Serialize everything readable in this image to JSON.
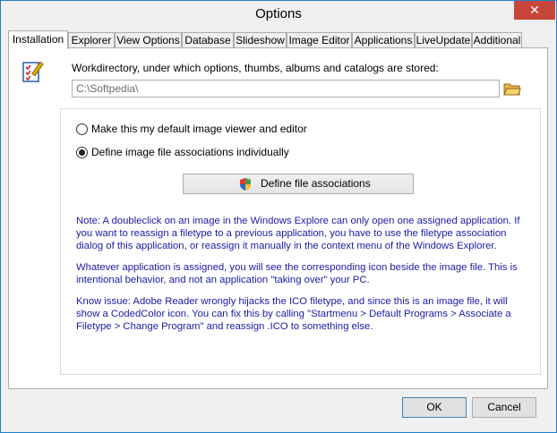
{
  "window": {
    "title": "Options",
    "close_glyph": "✕"
  },
  "tabs": [
    {
      "label": "Installation",
      "active": true
    },
    {
      "label": "Explorer"
    },
    {
      "label": "View Options"
    },
    {
      "label": "Database"
    },
    {
      "label": "Slideshow"
    },
    {
      "label": "Image Editor"
    },
    {
      "label": "Applications"
    },
    {
      "label": "LiveUpdate"
    },
    {
      "label": "Additional"
    }
  ],
  "installation": {
    "workdir_label": "Workdirectory, under which options, thumbs, albums and catalogs are stored:",
    "workdir_value": "C:\\Softpedia\\",
    "options": [
      {
        "label": "Make this my default image viewer and editor",
        "selected": false
      },
      {
        "label": "Define image file associations individually",
        "selected": true
      }
    ],
    "define_button_label": "Define file associations",
    "notes": [
      "Note: A doubleclick on an image in the Windows Explore can only open one assigned application. If you want to reassign a filetype to a previous application, you have to use the filetype association dialog of this application, or reassign it manually in the context menu of the Windows Explorer.",
      "Whatever application is assigned, you will see the corresponding icon beside the image file. This is intentional behavior, and not an application \"taking over\" your PC.",
      "Know issue: Adobe Reader wrongly hijacks the ICO filetype, and since this is an image file, it will show a CodedColor icon. You can fix this by calling \"Startmenu > Default Programs > Associate a Filetype > Change Program\" and reassign .ICO to something else."
    ]
  },
  "footer": {
    "ok_label": "OK",
    "cancel_label": "Cancel"
  },
  "colors": {
    "note_text": "#1a1aa6",
    "close_button": "#c7463a",
    "window_border": "#1f7fc8"
  }
}
